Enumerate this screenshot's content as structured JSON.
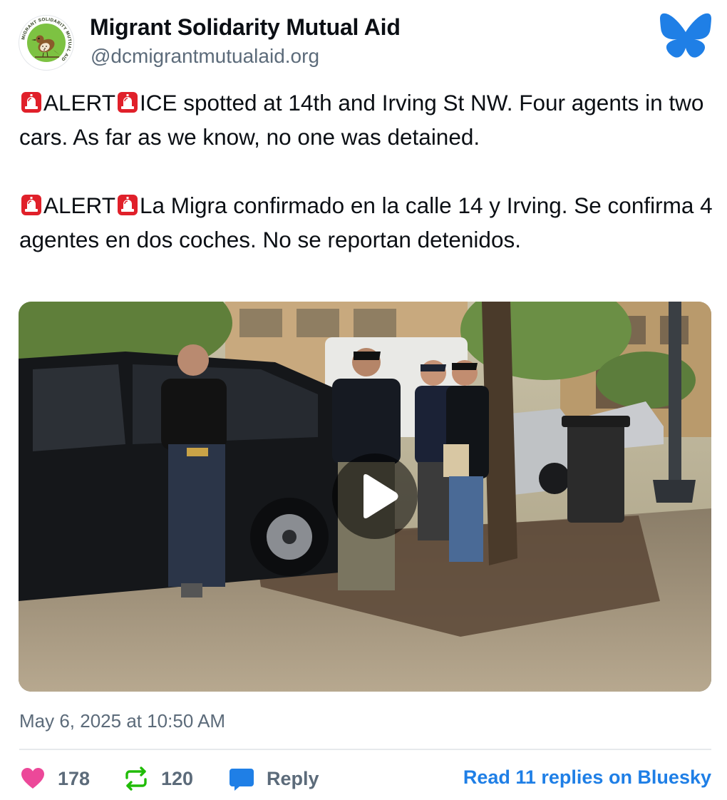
{
  "post": {
    "author_name": "Migrant Solidarity Mutual Aid",
    "author_handle": "@dcmigrantmutualaid.org",
    "avatar_icon": "bird-logo-icon",
    "avatar_ring_text": "MIGRANT SOLIDARITY MUTUAL AID",
    "platform_icon": "bluesky-butterfly-icon",
    "paragraphs": [
      {
        "alert_word": "ALERT",
        "text": "ICE spotted at 14th and Irving St NW. Four agents in two cars. As far as we know, no one was detained."
      },
      {
        "alert_word": "ALERT",
        "text": "La Migra confirmado en la calle 14 y Irving. Se confirma 4 agentes en dos coches. No se reportan detenidos."
      }
    ],
    "video": {
      "play_icon": "play-icon"
    },
    "timestamp": "May 6, 2025 at 10:50 AM"
  },
  "actions": {
    "likes": "178",
    "reposts": "120",
    "reply_label": "Reply",
    "read_replies_label": "Read 11 replies on Bluesky"
  },
  "colors": {
    "bluesky_blue": "#1f7fe6",
    "like_pink": "#ec4899",
    "repost_green": "#20bc07",
    "muted_text": "#5c6b7a",
    "alert_red": "#e0202a"
  }
}
